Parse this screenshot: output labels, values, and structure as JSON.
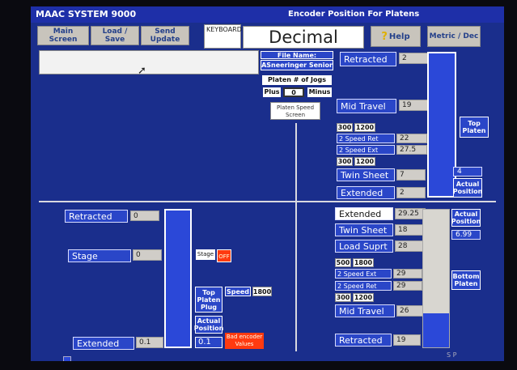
{
  "title_left": "MAAC SYSTEM 9000",
  "title_right": "Encoder Position For Platens",
  "toolbar": {
    "main_screen": "Main Screen",
    "load_save": "Load / Save",
    "send_update": "Send Update",
    "keyboard": "KEYBOARD",
    "decimal": "Decimal",
    "help": "Help",
    "metric": "Metric / Dec"
  },
  "file": {
    "label": "File Name:",
    "name": "ASneeringer Senior",
    "jogs_label": "Platen # of Jogs",
    "plus_label": "Plus",
    "plus_value": "0",
    "minus_label": "Minus",
    "platen_speed": "Platen Speed Screen"
  },
  "top_platen": {
    "retracted_label": "Retracted",
    "retracted_value": "2",
    "mid_travel_label": "Mid Travel",
    "mid_travel_value": "19",
    "speed_a1": "300",
    "speed_a2": "1200",
    "speed_ret_label": "2 Speed Ret",
    "speed_ret_value": "22",
    "speed_ext_label": "2 Speed Ext",
    "speed_ext_value": "27.5",
    "speed_b1": "300",
    "speed_b2": "1200",
    "twin_label": "Twin Sheet",
    "twin_value": "7",
    "extended_label": "Extended",
    "extended_value": "2",
    "top_platen_label": "Top Platen",
    "actual_value": "4",
    "actual_label": "Actual Position"
  },
  "stage": {
    "retracted_label": "Retracted",
    "retracted_value": "0",
    "stage_label": "Stage",
    "stage_value": "0",
    "extended_label": "Extended",
    "extended_value": "0.1",
    "stage_toggle_label": "Stage",
    "stage_toggle_state": "OFF",
    "top_platen_plug": "Top Platen Plug",
    "speed_label": "Speed",
    "speed_value": "1800",
    "actual_label": "Actual Position",
    "actual_value": "0.1",
    "bad_encoder": "Bad encoder Values"
  },
  "bottom_platen": {
    "extended_label": "Extended",
    "extended_value": "29.25",
    "twin_label": "Twin Sheet",
    "twin_value": "18",
    "load_label": "Load Suprt",
    "load_value": "28",
    "speed_a1": "500",
    "speed_a2": "1800",
    "speed_ext_label": "2 Speed Ext",
    "speed_ext_value": "29",
    "speed_ret_label": "2 Speed Ret",
    "speed_ret_value": "29",
    "speed_b1": "300",
    "speed_b2": "1200",
    "mid_travel_label": "Mid Travel",
    "mid_travel_value": "26",
    "retracted_label": "Retracted",
    "retracted_value": "19",
    "actual_label": "Actual Position",
    "actual_value": "6.99",
    "bottom_platen_label": "Bottom Platen",
    "gauge_fill": 0.25
  },
  "corner_text": "S P",
  "colors": {
    "screen": "#1a2e8c",
    "accent": "#2a46c8",
    "alert": "#ff3a10"
  }
}
